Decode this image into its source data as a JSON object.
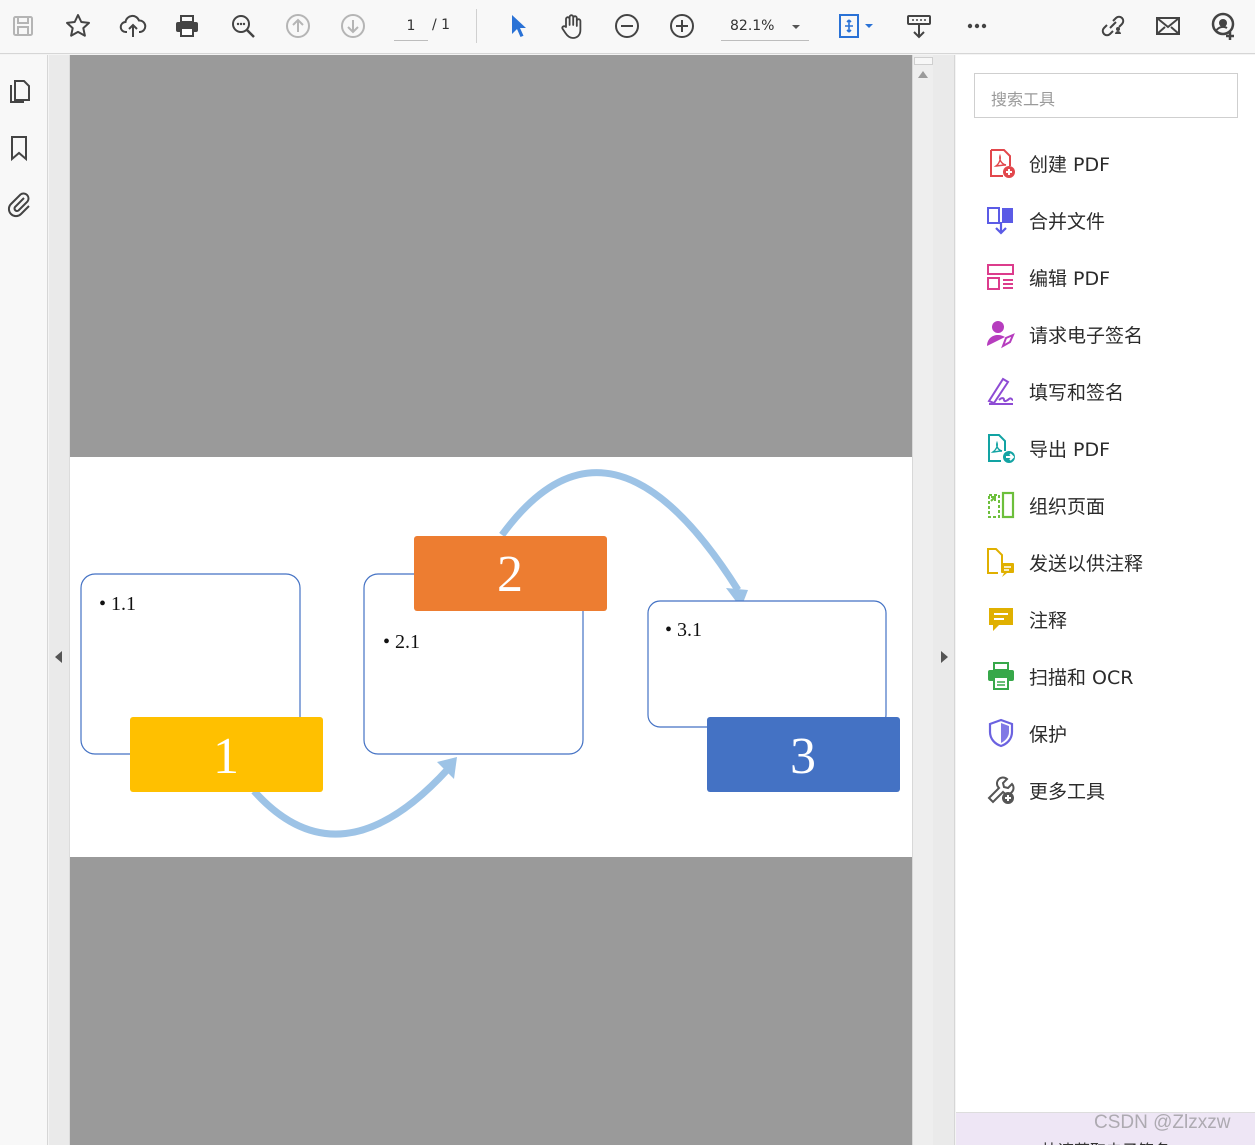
{
  "toolbar": {
    "page_current": "1",
    "page_total": "/ 1",
    "zoom": "82.1%",
    "icons": [
      "save-icon",
      "star-icon",
      "cloud-upload-icon",
      "print-icon",
      "find-text-icon",
      "page-up-icon",
      "page-down-icon",
      "select-arrow-icon",
      "hand-tool-icon",
      "zoom-out-icon",
      "zoom-in-icon",
      "page-fit-icon",
      "read-mode-icon",
      "more-icon",
      "share-link-icon",
      "email-icon",
      "account-icon"
    ]
  },
  "left_rail": {
    "icons": [
      "pages-icon",
      "bookmark-icon",
      "attachment-icon"
    ]
  },
  "document": {
    "boxes": [
      {
        "number": "1",
        "bullet": "• 1.1",
        "color": "#FFC000"
      },
      {
        "number": "2",
        "bullet": "• 2.1",
        "color": "#ED7D31"
      },
      {
        "number": "3",
        "bullet": "• 3.1",
        "color": "#4472C4"
      }
    ],
    "arrow_color": "#9DC3E6",
    "box_border_color": "#4472C4"
  },
  "tools_pane": {
    "search_placeholder": "搜索工具",
    "tools": [
      {
        "label": "创建 PDF",
        "icon": "create-pdf-icon",
        "color": "#E2474C"
      },
      {
        "label": "合并文件",
        "icon": "combine-files-icon",
        "color": "#5B5BE6"
      },
      {
        "label": "编辑 PDF",
        "icon": "edit-pdf-icon",
        "color": "#DC3C8C"
      },
      {
        "label": "请求电子签名",
        "icon": "request-esign-icon",
        "color": "#B63DBE"
      },
      {
        "label": "填写和签名",
        "icon": "fill-sign-icon",
        "color": "#8E4BD4"
      },
      {
        "label": "导出 PDF",
        "icon": "export-pdf-icon",
        "color": "#12A3A3"
      },
      {
        "label": "组织页面",
        "icon": "organize-pages-icon",
        "color": "#6DBF3C"
      },
      {
        "label": "发送以供注释",
        "icon": "send-comment-icon",
        "color": "#E0B000"
      },
      {
        "label": "注释",
        "icon": "comment-icon",
        "color": "#E0B000"
      },
      {
        "label": "扫描和 OCR",
        "icon": "scan-ocr-icon",
        "color": "#37A84A"
      },
      {
        "label": "保护",
        "icon": "protect-icon",
        "color": "#6B62E0"
      },
      {
        "label": "更多工具",
        "icon": "more-tools-icon",
        "color": "#555555"
      }
    ],
    "promo_text": "快速获取电子签名"
  },
  "watermark": "CSDN @Zlzxzw"
}
